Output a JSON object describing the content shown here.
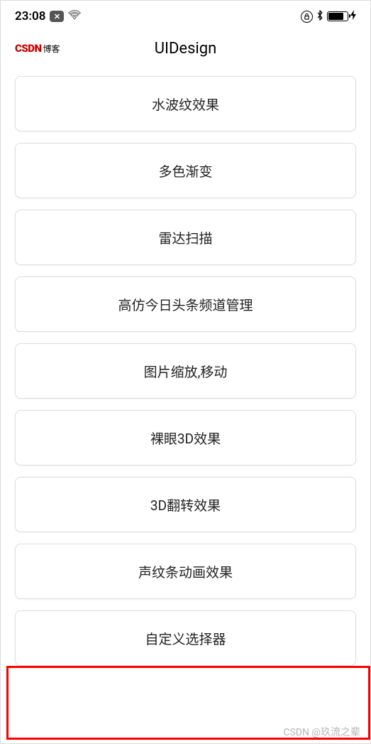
{
  "statusBar": {
    "time": "23:08",
    "xBadge": "✕"
  },
  "header": {
    "logoMain": "CSDN",
    "logoSuffix": "博客",
    "title": "UIDesign"
  },
  "items": [
    {
      "label": "水波纹效果"
    },
    {
      "label": "多色渐变"
    },
    {
      "label": "雷达扫描"
    },
    {
      "label": "高仿今日头条频道管理"
    },
    {
      "label": "图片缩放,移动"
    },
    {
      "label": "裸眼3D效果"
    },
    {
      "label": "3D翻转效果"
    },
    {
      "label": "声纹条动画效果"
    },
    {
      "label": "自定义选择器"
    }
  ],
  "watermark": "CSDN @玖流之辈"
}
